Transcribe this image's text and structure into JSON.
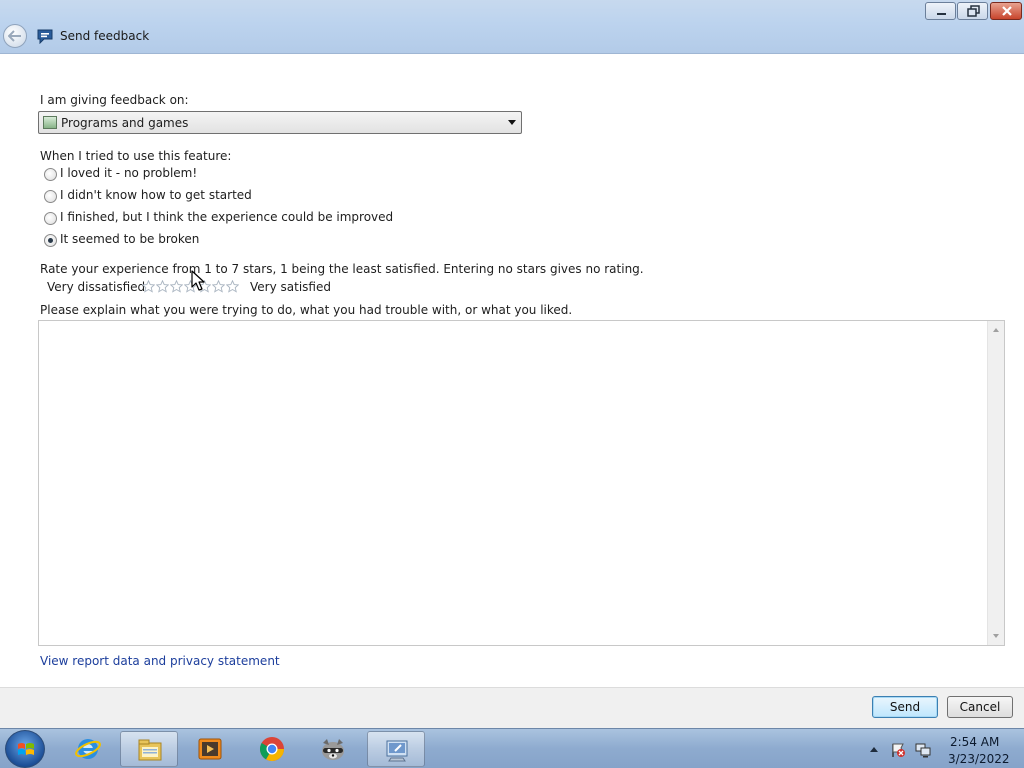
{
  "window": {
    "title": "Send feedback",
    "controls": {
      "minimize": "minimize",
      "maximize": "restore",
      "close": "close"
    }
  },
  "form": {
    "feedback_on_label": "I am giving feedback on:",
    "feedback_on_value": "Programs and games",
    "feature_question": "When I tried to use this feature:",
    "options": [
      {
        "label": "I loved it - no problem!",
        "checked": false
      },
      {
        "label": "I didn't know how to get started",
        "checked": false
      },
      {
        "label": "I finished, but I think the experience could be improved",
        "checked": false
      },
      {
        "label": "It seemed to be broken",
        "checked": true
      }
    ],
    "rating_instructions": "Rate your experience from 1 to 7 stars, 1 being the least satisfied.  Entering no stars gives no rating.",
    "rating_low_label": "Very dissatisfied",
    "rating_high_label": "Very satisfied",
    "rating_max": 7,
    "rating_value": 0,
    "explain_prompt": "Please explain what you were trying to do, what you had trouble with, or what you liked.",
    "explain_value": "",
    "privacy_link": "View report data and privacy statement"
  },
  "buttons": {
    "send": "Send",
    "cancel": "Cancel"
  },
  "taskbar": {
    "items": [
      "start-orb",
      "internet-explorer-icon",
      "file-explorer-icon",
      "media-player-icon",
      "chrome-icon",
      "raccoon-app-icon",
      "feedback-app-icon"
    ],
    "tray": {
      "time": "2:54 AM",
      "date": "3/23/2022"
    }
  },
  "colors": {
    "titlebar": "#bcd3ee",
    "link": "#1c3e9c",
    "taskbar": "#8eabcf",
    "send_button": "#bee6fd"
  }
}
